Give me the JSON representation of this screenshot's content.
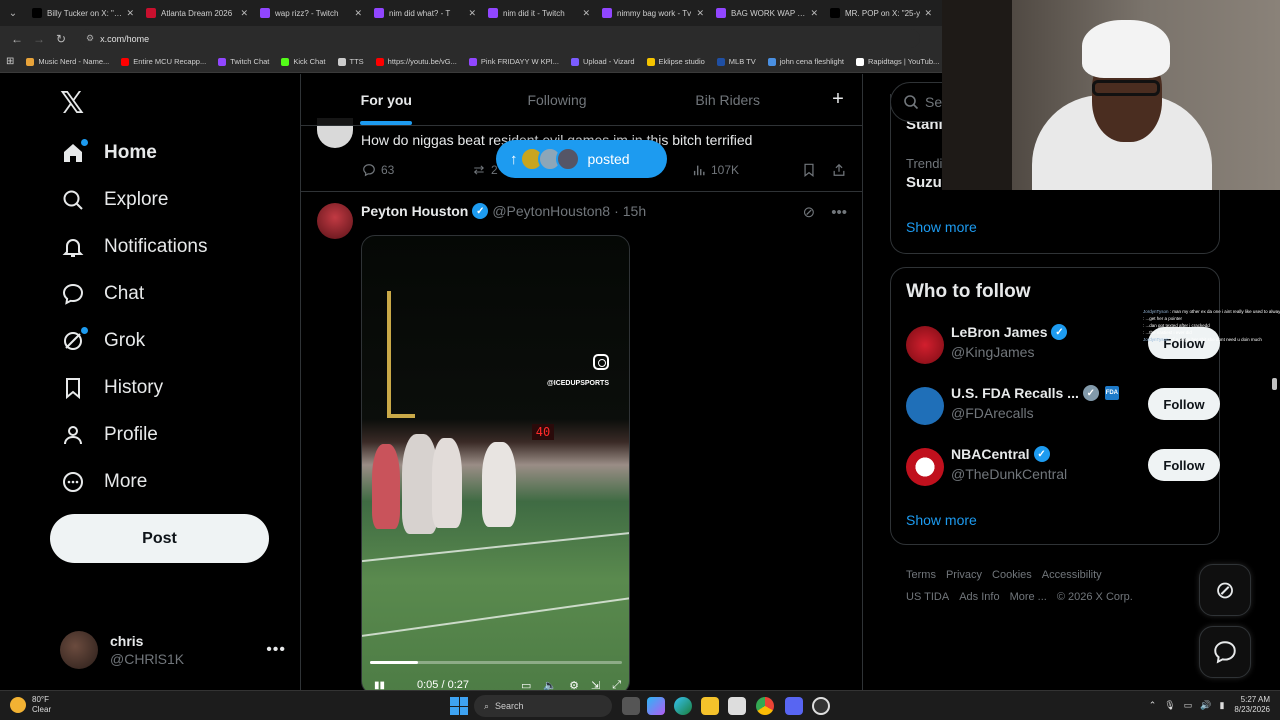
{
  "browser": {
    "tabs": [
      {
        "label": "Billy Tucker on X: \"Th",
        "color": "#000000"
      },
      {
        "label": "Atlanta Dream 2026",
        "color": "#c8102e"
      },
      {
        "label": "wap rizz? - Twitch",
        "color": "#9146ff"
      },
      {
        "label": "nim did what? - T",
        "color": "#9146ff"
      },
      {
        "label": "nim did it - Twitch",
        "color": "#9146ff"
      },
      {
        "label": "nimmy bag work - Tv",
        "color": "#9146ff"
      },
      {
        "label": "BAG WORK WAP - Tw",
        "color": "#9146ff"
      },
      {
        "label": "MR. POP on X: \"25-y",
        "color": "#000000"
      }
    ],
    "url": "x.com/home",
    "bookmarks": [
      {
        "label": "Music Nerd - Name...",
        "color": "#e8a33a"
      },
      {
        "label": "Entire MCU Recapp...",
        "color": "#ff0000"
      },
      {
        "label": "Twitch Chat",
        "color": "#9146ff"
      },
      {
        "label": "Kick Chat",
        "color": "#53fc18"
      },
      {
        "label": "TTS",
        "color": "#cccccc"
      },
      {
        "label": "https://youtu.be/vG...",
        "color": "#ff0000"
      },
      {
        "label": "Pink FRIDAYY W KPI...",
        "color": "#9146ff"
      },
      {
        "label": "Upload - Vizard",
        "color": "#7b5cff"
      },
      {
        "label": "Eklipse studio",
        "color": "#f5c400"
      },
      {
        "label": "MLB TV",
        "color": "#1f4fa3"
      },
      {
        "label": "john cena fleshlight",
        "color": "#4a90e2"
      },
      {
        "label": "Rapidtags | YouTub...",
        "color": "#ffffff"
      }
    ]
  },
  "nav": {
    "items": [
      {
        "label": "Home",
        "icon": "home-icon",
        "active": true,
        "dot": true
      },
      {
        "label": "Explore",
        "icon": "search-icon"
      },
      {
        "label": "Notifications",
        "icon": "bell-icon"
      },
      {
        "label": "Chat",
        "icon": "chat-icon"
      },
      {
        "label": "Grok",
        "icon": "grok-icon",
        "dot": true
      },
      {
        "label": "History",
        "icon": "bookmark-icon"
      },
      {
        "label": "Profile",
        "icon": "person-icon"
      },
      {
        "label": "More",
        "icon": "more-circle-icon"
      }
    ],
    "post_label": "Post",
    "account": {
      "name": "chris",
      "handle": "@CHRlS1K"
    }
  },
  "feed": {
    "tabs": [
      "For you",
      "Following",
      "Bih Riders"
    ],
    "new_posts_label": "posted",
    "tweet1": {
      "text": "How do niggas beat resident evil games im in this bitch terrified",
      "replies": "63",
      "reposts": "2",
      "views": "107K"
    },
    "tweet2": {
      "name": "Peyton Houston",
      "handle": "@PeytonHouston8",
      "time": "15h",
      "video": {
        "watermark": "@ICEDUPSPORTS",
        "scoreboard": "40",
        "time": "0:05 / 0:27",
        "progress": 0.19
      }
    }
  },
  "right": {
    "search_placeholder": "Sea",
    "trend_top": "Stani",
    "trend_category": "Trendi",
    "trend_name": "Suzu",
    "show_more": "Show more",
    "who_to_follow_title": "Who to follow",
    "follow_label": "Follow",
    "suggestions": [
      {
        "name": "LeBron James",
        "handle": "@KingJames",
        "verified": "blue"
      },
      {
        "name": "U.S. FDA Recalls ...",
        "handle": "@FDArecalls",
        "verified": "grey",
        "badge": "FDA"
      },
      {
        "name": "NBACentral",
        "handle": "@TheDunkCentral",
        "verified": "blue"
      }
    ],
    "footer": {
      "line1": [
        "Terms",
        "Privacy",
        "Cookies",
        "Accessibility"
      ],
      "line2": [
        "US TIDA",
        "Ads Info",
        "More ...",
        "© 2026 X Corp."
      ]
    }
  },
  "chat_overlay": [
    {
      "user": "JordynTyson",
      "msg": "man my other ex da one i aint really like used to always like cheesecake"
    },
    {
      "user": "",
      "msg": "...get her a pointer"
    },
    {
      "user": "",
      "msg": "...dan got texted after i crackedd"
    },
    {
      "user": "",
      "msg": "...the nastiest i ever did"
    },
    {
      "user": "JordynTyson",
      "msg": "if u buyin her shit she dont need u doin much"
    }
  ],
  "taskbar": {
    "weather_temp": "80°F",
    "weather_cond": "Clear",
    "search_label": "Search",
    "time": "5:27 AM",
    "date": "8/23/2026"
  }
}
